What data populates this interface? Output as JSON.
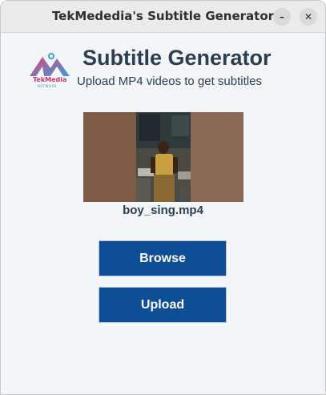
{
  "window": {
    "title": "TekMededia's Subtitle Generator",
    "minimize_glyph": "–",
    "close_glyph": "✕"
  },
  "logo": {
    "brand_text": "TekMedia",
    "tagline": "NETWORK",
    "icon": "tekmedia-logo-icon"
  },
  "header": {
    "title": "Subtitle Generator",
    "subtitle": "Upload MP4 videos to get subtitles"
  },
  "video": {
    "filename": "boy_sing.mp4"
  },
  "buttons": {
    "browse_label": "Browse",
    "upload_label": "Upload"
  },
  "colors": {
    "button_bg": "#0d4e96",
    "text_primary": "#2c3e50",
    "background": "#f3f6f9"
  }
}
